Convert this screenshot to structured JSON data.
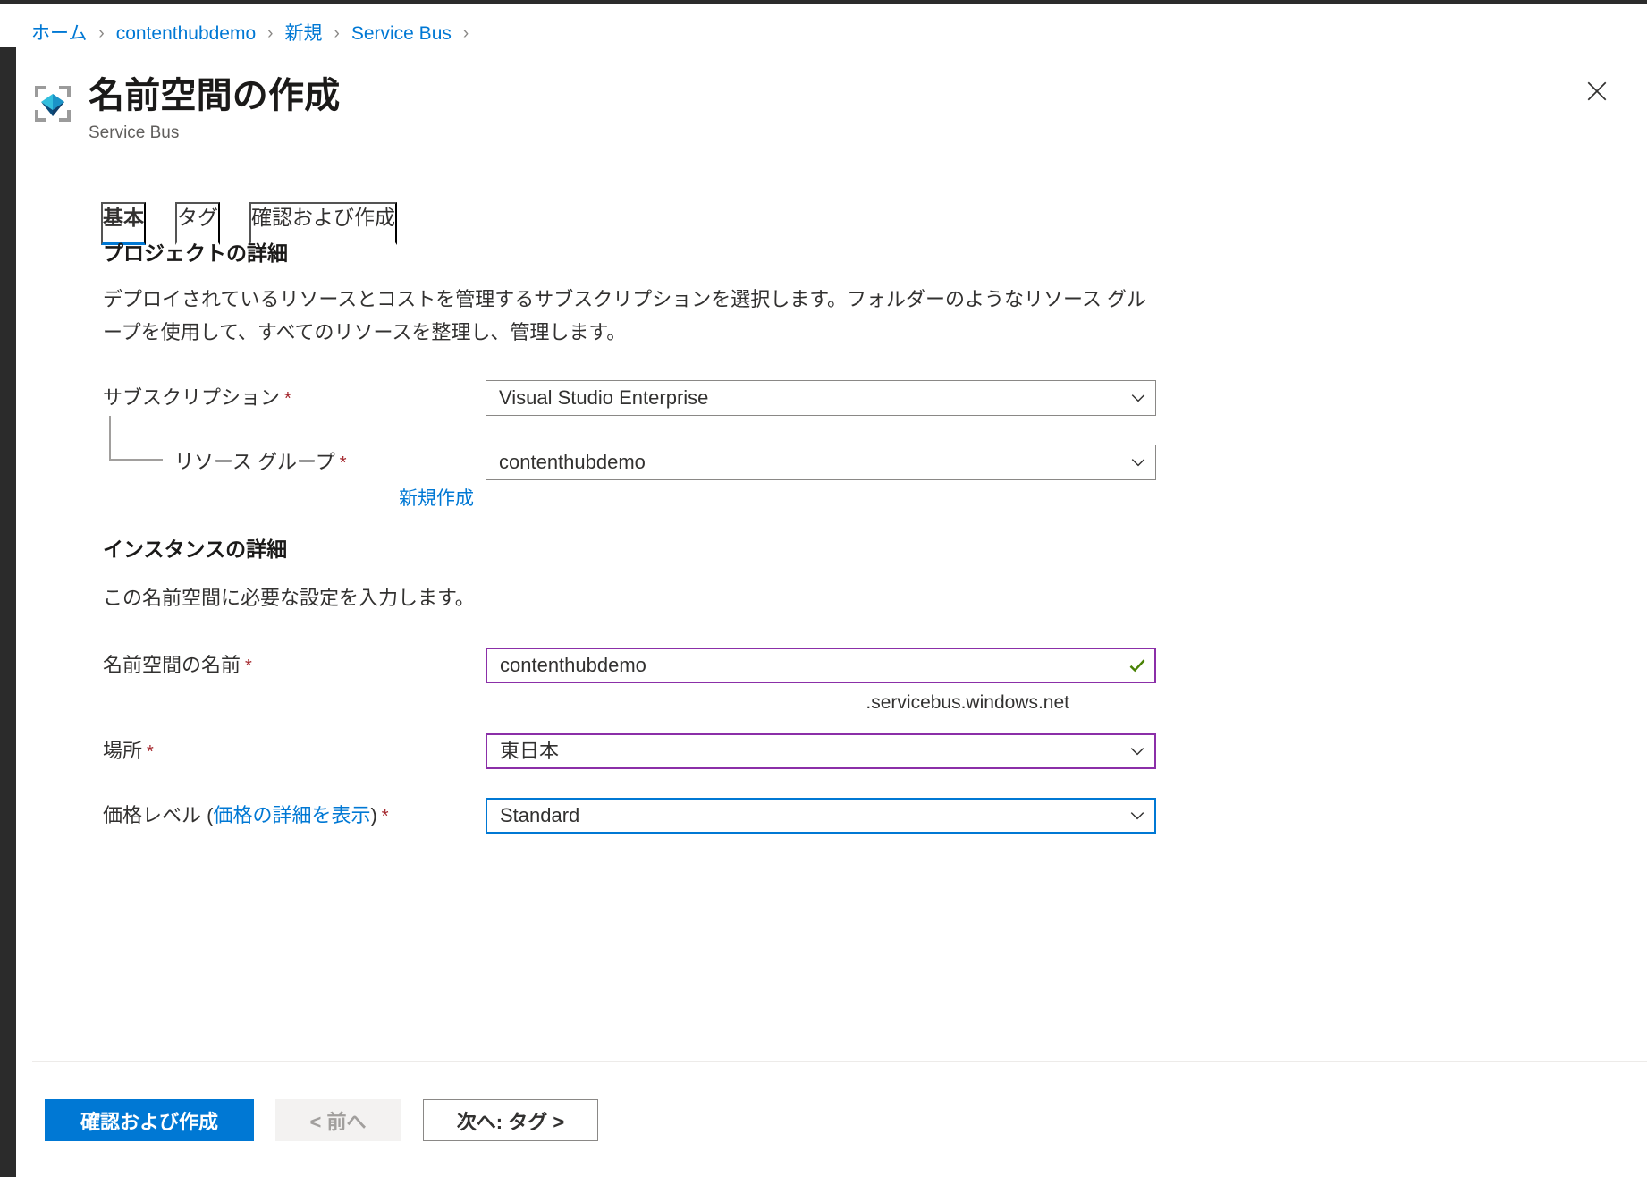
{
  "breadcrumb": {
    "separator": "›",
    "items": [
      {
        "label": "ホーム"
      },
      {
        "label": "contenthubdemo"
      },
      {
        "label": "新規"
      },
      {
        "label": "Service Bus"
      }
    ],
    "trailing_separator": "›"
  },
  "header": {
    "title": "名前空間の作成",
    "subtitle": "Service Bus",
    "icon": "service-bus-icon",
    "close_label": "✕"
  },
  "tabs": [
    {
      "label": "基本",
      "active": true
    },
    {
      "label": "タグ",
      "active": false
    },
    {
      "label": "確認および作成",
      "active": false
    }
  ],
  "project_details": {
    "heading": "プロジェクトの詳細",
    "description": "デプロイされているリソースとコストを管理するサブスクリプションを選択します。フォルダーのようなリソース グループを使用して、すべてのリソースを整理し、管理します。",
    "subscription": {
      "label": "サブスクリプション",
      "required_marker": "*",
      "value": "Visual Studio Enterprise"
    },
    "resource_group": {
      "label": "リソース グループ",
      "required_marker": "*",
      "value": "contenthubdemo",
      "create_new_label": "新規作成"
    }
  },
  "instance_details": {
    "heading": "インスタンスの詳細",
    "description": "この名前空間に必要な設定を入力します。",
    "namespace_name": {
      "label": "名前空間の名前",
      "required_marker": "*",
      "value": "contenthubdemo",
      "suffix": ".servicebus.windows.net",
      "validation": "valid"
    },
    "location": {
      "label": "場所",
      "required_marker": "*",
      "value": "東日本"
    },
    "pricing_tier": {
      "label_prefix": "価格レベル (",
      "label_link": "価格の詳細を表示",
      "label_suffix": ")",
      "required_marker": "*",
      "value": "Standard"
    }
  },
  "footer": {
    "review_create_label": "確認および作成",
    "previous_label": "< 前へ",
    "next_label": "次へ: タグ >"
  },
  "colors": {
    "accent_blue": "#0078d4",
    "link_blue": "#0078d4",
    "required_red": "#a4262c",
    "validation_green": "#498205",
    "modified_purple": "#8b2fa8",
    "border_gray": "#8a8886"
  }
}
